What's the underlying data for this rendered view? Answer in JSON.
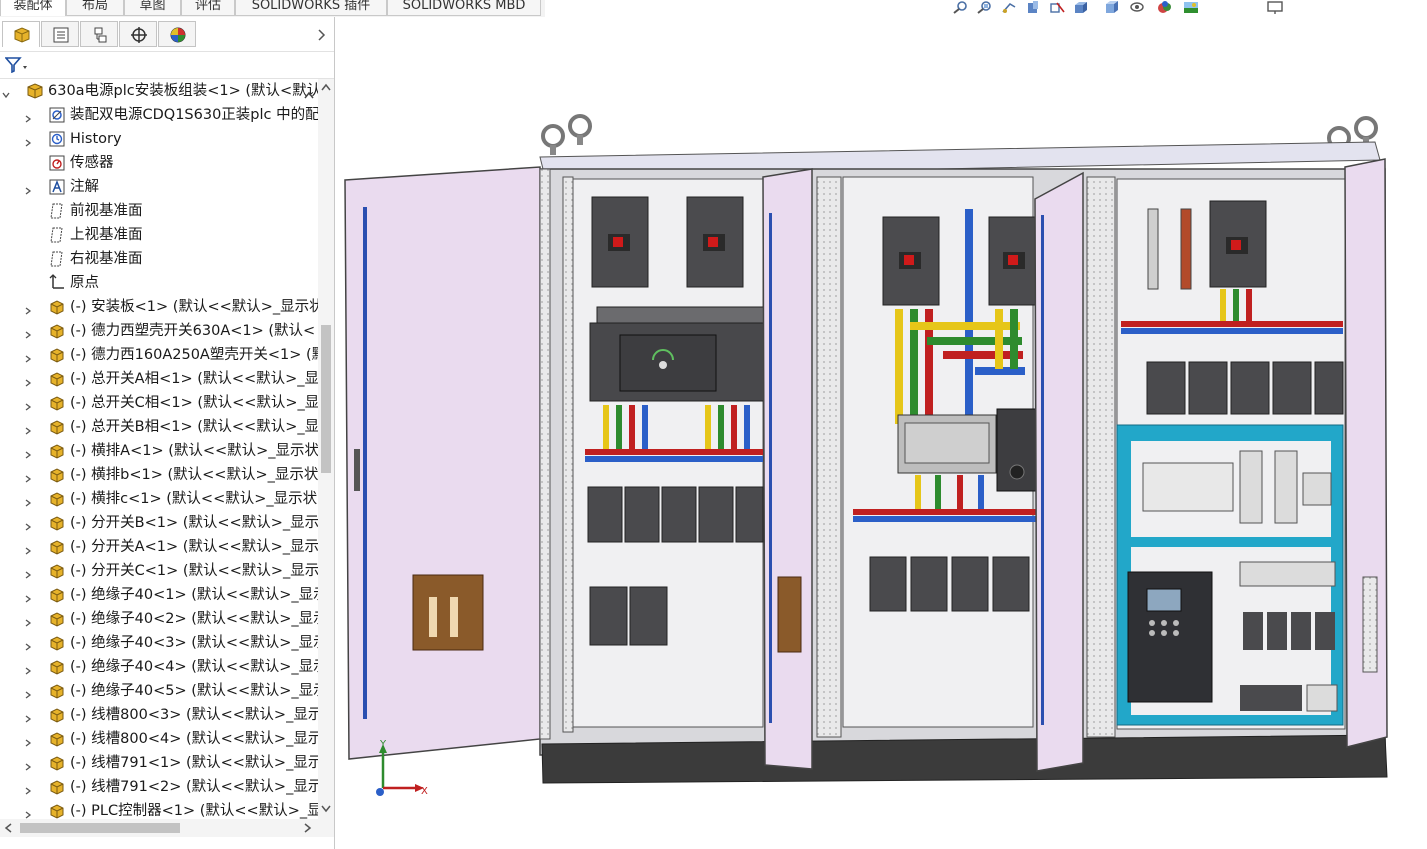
{
  "commandmanager": {
    "tabs": [
      {
        "label": "装配体",
        "active": true
      },
      {
        "label": "布局",
        "active": false
      },
      {
        "label": "草图",
        "active": false
      },
      {
        "label": "评估",
        "active": false
      },
      {
        "label": "SOLIDWORKS 插件",
        "active": false
      },
      {
        "label": "SOLIDWORKS MBD",
        "active": false
      }
    ]
  },
  "heads_up_toolbar": {
    "icons": [
      "zoom-to-fit-icon",
      "zoom-area-icon",
      "previous-view-icon",
      "section-view-icon",
      "dynamic-annotation-icon",
      "view-orientation-icon",
      "display-style-icon",
      "hide-show-icon",
      "edit-appearance-icon",
      "apply-scene-icon",
      "view-settings-icon"
    ]
  },
  "panel_tabs": [
    {
      "icon": "feature-manager-icon",
      "active": true
    },
    {
      "icon": "property-manager-icon",
      "active": false
    },
    {
      "icon": "configuration-manager-icon",
      "active": false
    },
    {
      "icon": "dimxpert-manager-icon",
      "active": false
    },
    {
      "icon": "display-manager-icon",
      "active": false
    }
  ],
  "filter_icon": "filter-icon",
  "tree": {
    "root": "630a电源plc安装板组装<1> (默认<默认",
    "items": [
      {
        "label": "装配双电源CDQ1S630正装plc 中的配",
        "icon": "mate-reference-icon",
        "expand": true
      },
      {
        "label": "History",
        "icon": "history-icon",
        "expand": true
      },
      {
        "label": "传感器",
        "icon": "sensor-icon",
        "expand": false
      },
      {
        "label": "注解",
        "icon": "annotation-icon",
        "expand": true
      },
      {
        "label": "前视基准面",
        "icon": "plane-icon",
        "expand": false
      },
      {
        "label": "上视基准面",
        "icon": "plane-icon",
        "expand": false
      },
      {
        "label": "右视基准面",
        "icon": "plane-icon",
        "expand": false
      },
      {
        "label": "原点",
        "icon": "origin-icon",
        "expand": false
      },
      {
        "label": "(-) 安装板<1> (默认<<默认>_显示状",
        "icon": "part-icon",
        "expand": true
      },
      {
        "label": "(-) 德力西塑壳开关630A<1> (默认<",
        "icon": "part-icon",
        "expand": true
      },
      {
        "label": "(-) 德力西160A250A塑壳开关<1> (默",
        "icon": "part-icon",
        "expand": true
      },
      {
        "label": "(-) 总开关A相<1> (默认<<默认>_显",
        "icon": "part-icon",
        "expand": true
      },
      {
        "label": "(-) 总开关C相<1> (默认<<默认>_显",
        "icon": "part-icon",
        "expand": true
      },
      {
        "label": "(-) 总开关B相<1> (默认<<默认>_显",
        "icon": "part-icon",
        "expand": true
      },
      {
        "label": "(-) 横排A<1> (默认<<默认>_显示状",
        "icon": "part-icon",
        "expand": true
      },
      {
        "label": "(-) 横排b<1> (默认<<默认>_显示状",
        "icon": "part-icon",
        "expand": true
      },
      {
        "label": "(-) 横排c<1> (默认<<默认>_显示状",
        "icon": "part-icon",
        "expand": true
      },
      {
        "label": "(-) 分开关B<1> (默认<<默认>_显示",
        "icon": "part-icon",
        "expand": true
      },
      {
        "label": "(-) 分开关A<1> (默认<<默认>_显示",
        "icon": "part-icon",
        "expand": true
      },
      {
        "label": "(-) 分开关C<1> (默认<<默认>_显示",
        "icon": "part-icon",
        "expand": true
      },
      {
        "label": "(-) 绝缘子40<1> (默认<<默认>_显示",
        "icon": "part-icon",
        "expand": true
      },
      {
        "label": "(-) 绝缘子40<2> (默认<<默认>_显示",
        "icon": "part-icon",
        "expand": true
      },
      {
        "label": "(-) 绝缘子40<3> (默认<<默认>_显示",
        "icon": "part-icon",
        "expand": true
      },
      {
        "label": "(-) 绝缘子40<4> (默认<<默认>_显示",
        "icon": "part-icon",
        "expand": true
      },
      {
        "label": "(-) 绝缘子40<5> (默认<<默认>_显示",
        "icon": "part-icon",
        "expand": true
      },
      {
        "label": "(-) 线槽800<3> (默认<<默认>_显示",
        "icon": "part-icon",
        "expand": true
      },
      {
        "label": "(-) 线槽800<4> (默认<<默认>_显示",
        "icon": "part-icon",
        "expand": true
      },
      {
        "label": "(-) 线槽791<1> (默认<<默认>_显示",
        "icon": "part-icon",
        "expand": true
      },
      {
        "label": "(-) 线槽791<2> (默认<<默认>_显示",
        "icon": "part-icon",
        "expand": true
      },
      {
        "label": "(-) PLC控制器<1> (默认<<默认>_显",
        "icon": "part-icon",
        "expand": true
      }
    ]
  },
  "triad": {
    "x_label": "X",
    "y_label": "Y"
  },
  "colors": {
    "accent_blue": "#1f6fd1",
    "busbar_yellow": "#e6c619",
    "busbar_green": "#2e8b2e",
    "busbar_red": "#c02020",
    "busbar_blue": "#2b5fc8",
    "door_lilac": "#eadbef",
    "panel_gray": "#e8e8ea",
    "trunking_cyan": "#22a7c9"
  }
}
